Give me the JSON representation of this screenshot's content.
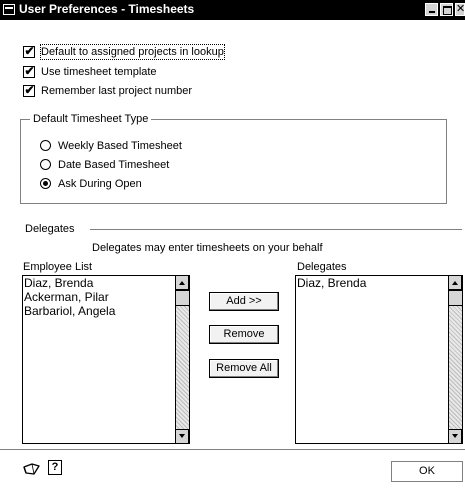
{
  "window": {
    "title": "User Preferences - Timesheets",
    "close_glyph": "✕",
    "icons": [
      "system-menu-icon",
      "minimize-icon",
      "maximize-icon",
      "close-icon"
    ]
  },
  "options": {
    "default_assigned": {
      "label": "Default to assigned projects in lookup",
      "checked": true
    },
    "use_template": {
      "label": "Use timesheet template",
      "checked": true
    },
    "remember_project": {
      "label": "Remember last project number",
      "checked": true
    },
    "check_glyph": "✔"
  },
  "timesheet_type": {
    "title": "Default Timesheet Type",
    "options": [
      {
        "label": "Weekly Based Timesheet",
        "selected": false
      },
      {
        "label": "Date Based Timesheet",
        "selected": false
      },
      {
        "label": "Ask During Open",
        "selected": true
      }
    ]
  },
  "delegates": {
    "section_title": "Delegates",
    "note": "Delegates may enter timesheets on your behalf",
    "employee_list_label": "Employee List",
    "delegates_list_label": "Delegates",
    "employees": [
      "Diaz, Brenda",
      "Ackerman, Pilar",
      "Barbariol, Angela"
    ],
    "selected_delegates": [
      "Diaz, Brenda"
    ],
    "add_label": "Add >>",
    "remove_label": "Remove",
    "remove_all_label": "Remove All"
  },
  "footer": {
    "ok_label": "OK",
    "help_glyph": "?",
    "icons": [
      "note-icon",
      "help-icon"
    ]
  }
}
